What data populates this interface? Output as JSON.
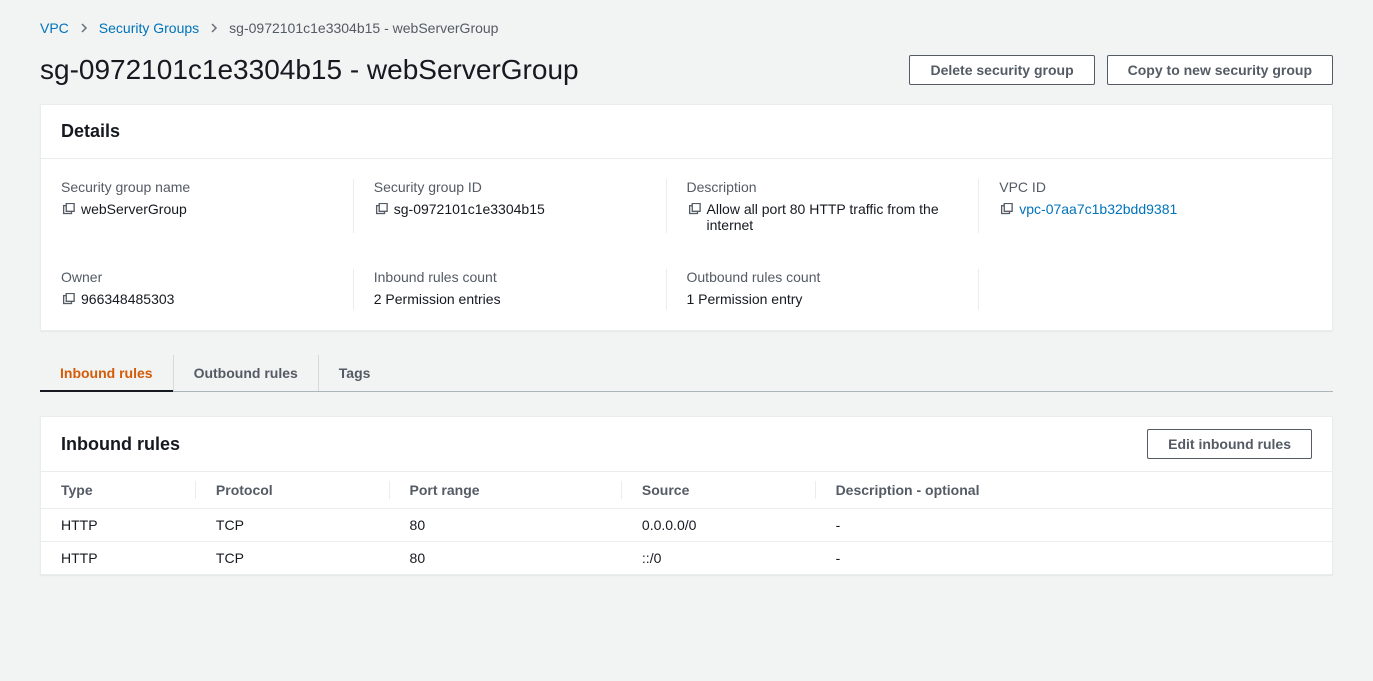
{
  "breadcrumb": {
    "vpc": "VPC",
    "securityGroups": "Security Groups",
    "current": "sg-0972101c1e3304b15 - webServerGroup"
  },
  "pageTitle": "sg-0972101c1e3304b15 - webServerGroup",
  "actions": {
    "delete": "Delete security group",
    "copy": "Copy to new security group"
  },
  "details": {
    "heading": "Details",
    "labels": {
      "name": "Security group name",
      "id": "Security group ID",
      "description": "Description",
      "vpcId": "VPC ID",
      "owner": "Owner",
      "inboundCount": "Inbound rules count",
      "outboundCount": "Outbound rules count"
    },
    "values": {
      "name": "webServerGroup",
      "id": "sg-0972101c1e3304b15",
      "description": "Allow all port 80 HTTP traffic from the internet",
      "vpcId": "vpc-07aa7c1b32bdd9381",
      "owner": "966348485303",
      "inboundCount": "2 Permission entries",
      "outboundCount": "1 Permission entry"
    }
  },
  "tabs": {
    "inbound": "Inbound rules",
    "outbound": "Outbound rules",
    "tags": "Tags"
  },
  "inboundPanel": {
    "heading": "Inbound rules",
    "editButton": "Edit inbound rules",
    "columns": {
      "type": "Type",
      "protocol": "Protocol",
      "portRange": "Port range",
      "source": "Source",
      "description": "Description - optional"
    },
    "rows": [
      {
        "type": "HTTP",
        "protocol": "TCP",
        "portRange": "80",
        "source": "0.0.0.0/0",
        "description": "-"
      },
      {
        "type": "HTTP",
        "protocol": "TCP",
        "portRange": "80",
        "source": "::/0",
        "description": "-"
      }
    ]
  }
}
